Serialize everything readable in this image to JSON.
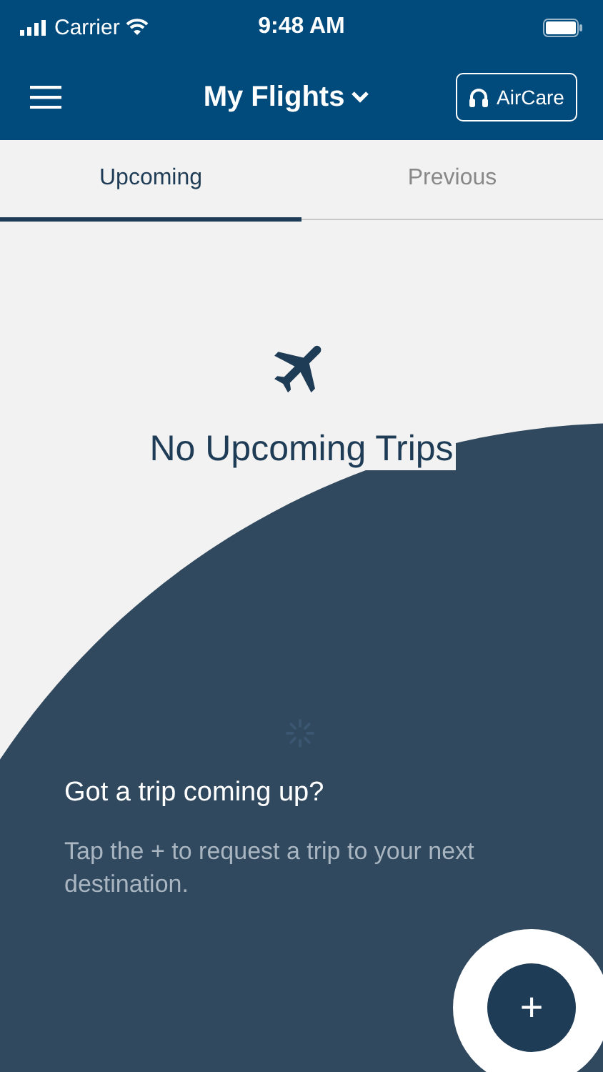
{
  "status_bar": {
    "carrier": "Carrier",
    "time": "9:48 AM"
  },
  "header": {
    "title": "My Flights",
    "support_button": "AirCare"
  },
  "tabs": [
    {
      "label": "Upcoming",
      "selected": true
    },
    {
      "label": "Previous",
      "selected": false
    }
  ],
  "empty_state": {
    "message": "No Upcoming Trips"
  },
  "coach_mark": {
    "title": "Got a trip coming up?",
    "text": "Tap the + to request a trip to your next destination."
  },
  "add_button": {
    "label": "+"
  }
}
